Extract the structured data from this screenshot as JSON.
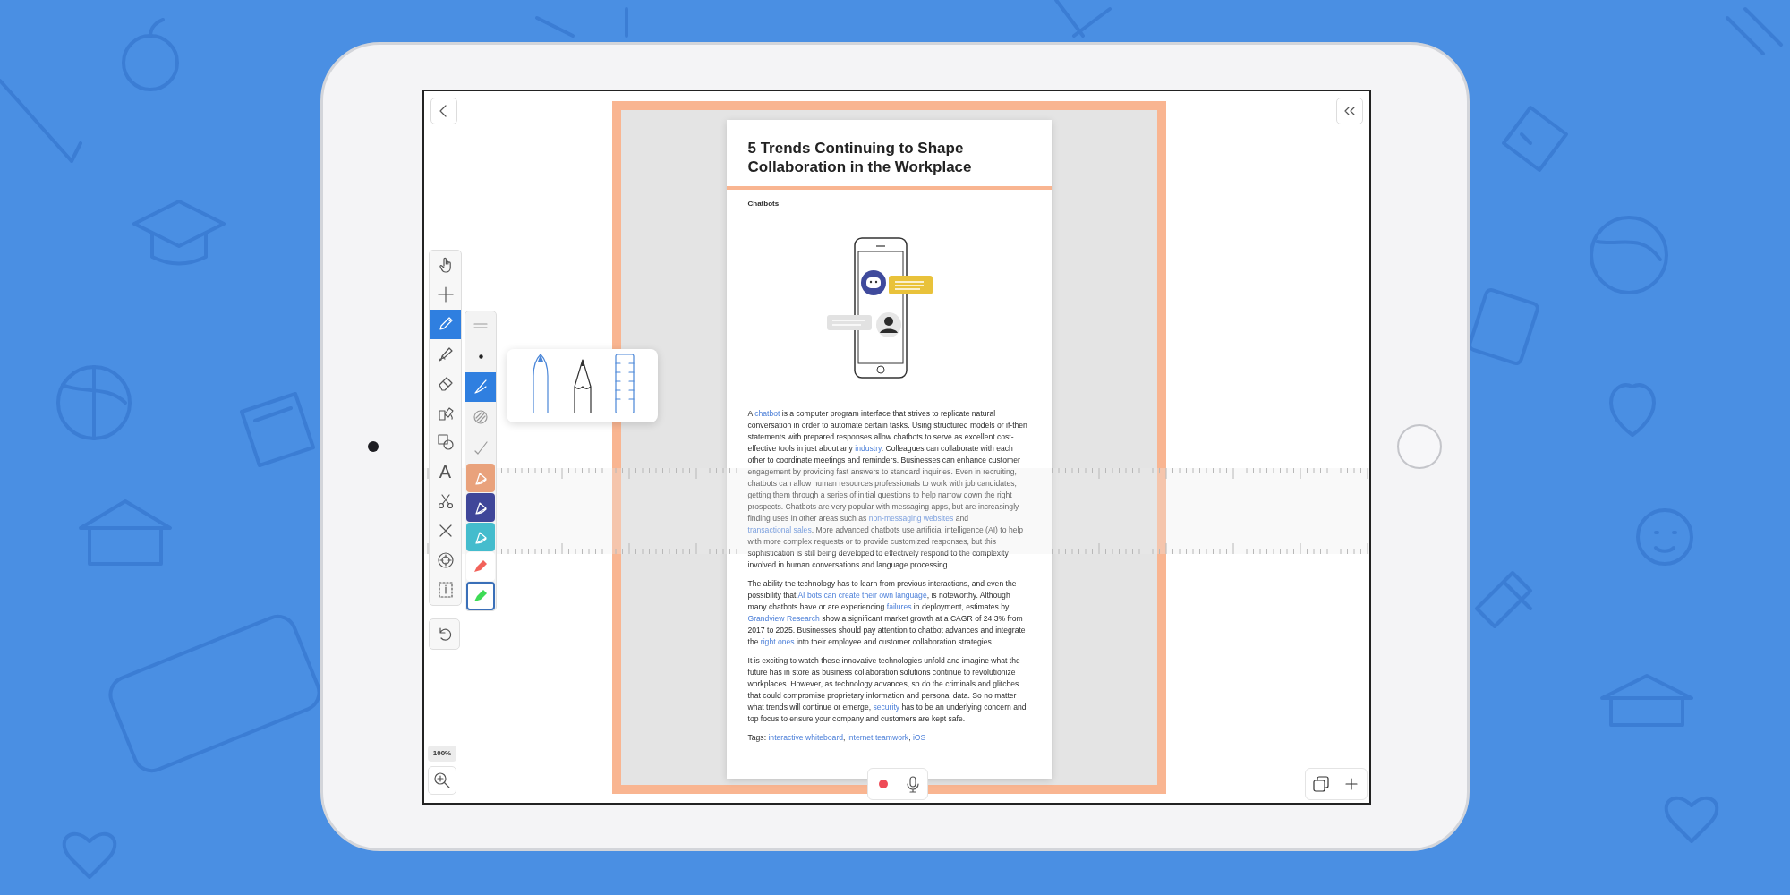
{
  "toolbar": {
    "tools": [
      {
        "kind": "hand",
        "selected": false
      },
      {
        "kind": "add",
        "selected": false
      },
      {
        "kind": "pen",
        "selected": true
      },
      {
        "kind": "highlighter",
        "selected": false
      },
      {
        "kind": "eraser",
        "selected": false
      },
      {
        "kind": "fill",
        "selected": false
      },
      {
        "kind": "shapes",
        "selected": false
      },
      {
        "kind": "text",
        "label": "A",
        "selected": false
      },
      {
        "kind": "scissors",
        "selected": false
      },
      {
        "kind": "delete",
        "selected": false
      },
      {
        "kind": "target",
        "selected": false
      },
      {
        "kind": "select",
        "selected": false
      }
    ],
    "stroke_options": [
      {
        "kind": "lines",
        "selected": false
      },
      {
        "kind": "dot",
        "selected": false
      },
      {
        "kind": "pen",
        "selected": true
      },
      {
        "kind": "hatch",
        "selected": false
      },
      {
        "kind": "check",
        "selected": false
      }
    ],
    "colors": [
      {
        "kind": "pen",
        "color": "#e9a27c",
        "selected": false
      },
      {
        "kind": "pen",
        "color": "#3f4699",
        "selected": false
      },
      {
        "kind": "pen",
        "color": "#44bccd",
        "selected": false
      },
      {
        "kind": "marker",
        "color": "#f2625a",
        "selected": false
      },
      {
        "kind": "marker",
        "color": "#3ddb55",
        "selected": true
      }
    ]
  },
  "document": {
    "title": "5 Trends Continuing to Shape Collaboration in the Workplace",
    "section": "Chatbots",
    "paragraphs": [
      [
        {
          "kind": "text",
          "text": "A "
        },
        {
          "kind": "link",
          "text": "chatbot"
        },
        {
          "kind": "text",
          "text": " is a computer program interface that strives to replicate natural conversation in order to automate certain tasks. Using structured models or if-then statements with prepared responses allow chatbots to serve as excellent cost-effective tools in just about any "
        },
        {
          "kind": "link",
          "text": "industry"
        },
        {
          "kind": "text",
          "text": ". Colleagues can collaborate with each other to coordinate meetings and reminders. Businesses can enhance customer engagement by providing fast answers to standard inquiries. Even in recruiting, chatbots can allow human resources professionals to work with job candidates, getting them through a series of initial questions to help narrow down the right prospects. Chatbots are very popular with messaging apps, but are increasingly finding uses in other areas such as "
        },
        {
          "kind": "link",
          "text": "non-messaging websites"
        },
        {
          "kind": "text",
          "text": " and "
        },
        {
          "kind": "link",
          "text": "transactional sales"
        },
        {
          "kind": "text",
          "text": ". More advanced chatbots use artificial intelligence (AI) to help with more complex requests or to provide customized responses, but this sophistication is still being developed to effectively respond to the complexity involved in human conversations and language processing."
        }
      ],
      [
        {
          "kind": "text",
          "text": "The ability the technology has to learn from previous interactions, and even the possibility that "
        },
        {
          "kind": "link",
          "text": "AI bots can create their own language"
        },
        {
          "kind": "text",
          "text": ", is noteworthy. Although many chatbots have or are experiencing "
        },
        {
          "kind": "link",
          "text": "failures"
        },
        {
          "kind": "text",
          "text": " in deployment, estimates by "
        },
        {
          "kind": "link",
          "text": "Grandview Research"
        },
        {
          "kind": "text",
          "text": " show a significant market growth at a CAGR of 24.3% from 2017 to 2025. Businesses should pay attention to chatbot advances and integrate the "
        },
        {
          "kind": "link",
          "text": "right ones"
        },
        {
          "kind": "text",
          "text": " into their employee and customer collaboration strategies."
        }
      ],
      [
        {
          "kind": "text",
          "text": "It is exciting to watch these innovative technologies unfold and imagine what the future has in store as business collaboration solutions continue to revolutionize workplaces. However, as technology advances, so do the criminals and glitches that could compromise proprietary information and personal data. So no matter what trends will continue or emerge, "
        },
        {
          "kind": "link",
          "text": "security"
        },
        {
          "kind": "text",
          "text": " has to be an underlying concern and top focus to ensure your company and customers are kept safe."
        }
      ],
      [
        {
          "kind": "text",
          "text": "Tags: "
        },
        {
          "kind": "link",
          "text": "interactive whiteboard"
        },
        {
          "kind": "text",
          "text": ", "
        },
        {
          "kind": "link",
          "text": "internet teamwork"
        },
        {
          "kind": "text",
          "text": ", "
        },
        {
          "kind": "link",
          "text": "iOS"
        }
      ]
    ]
  },
  "zoom": {
    "level_label": "100%"
  }
}
